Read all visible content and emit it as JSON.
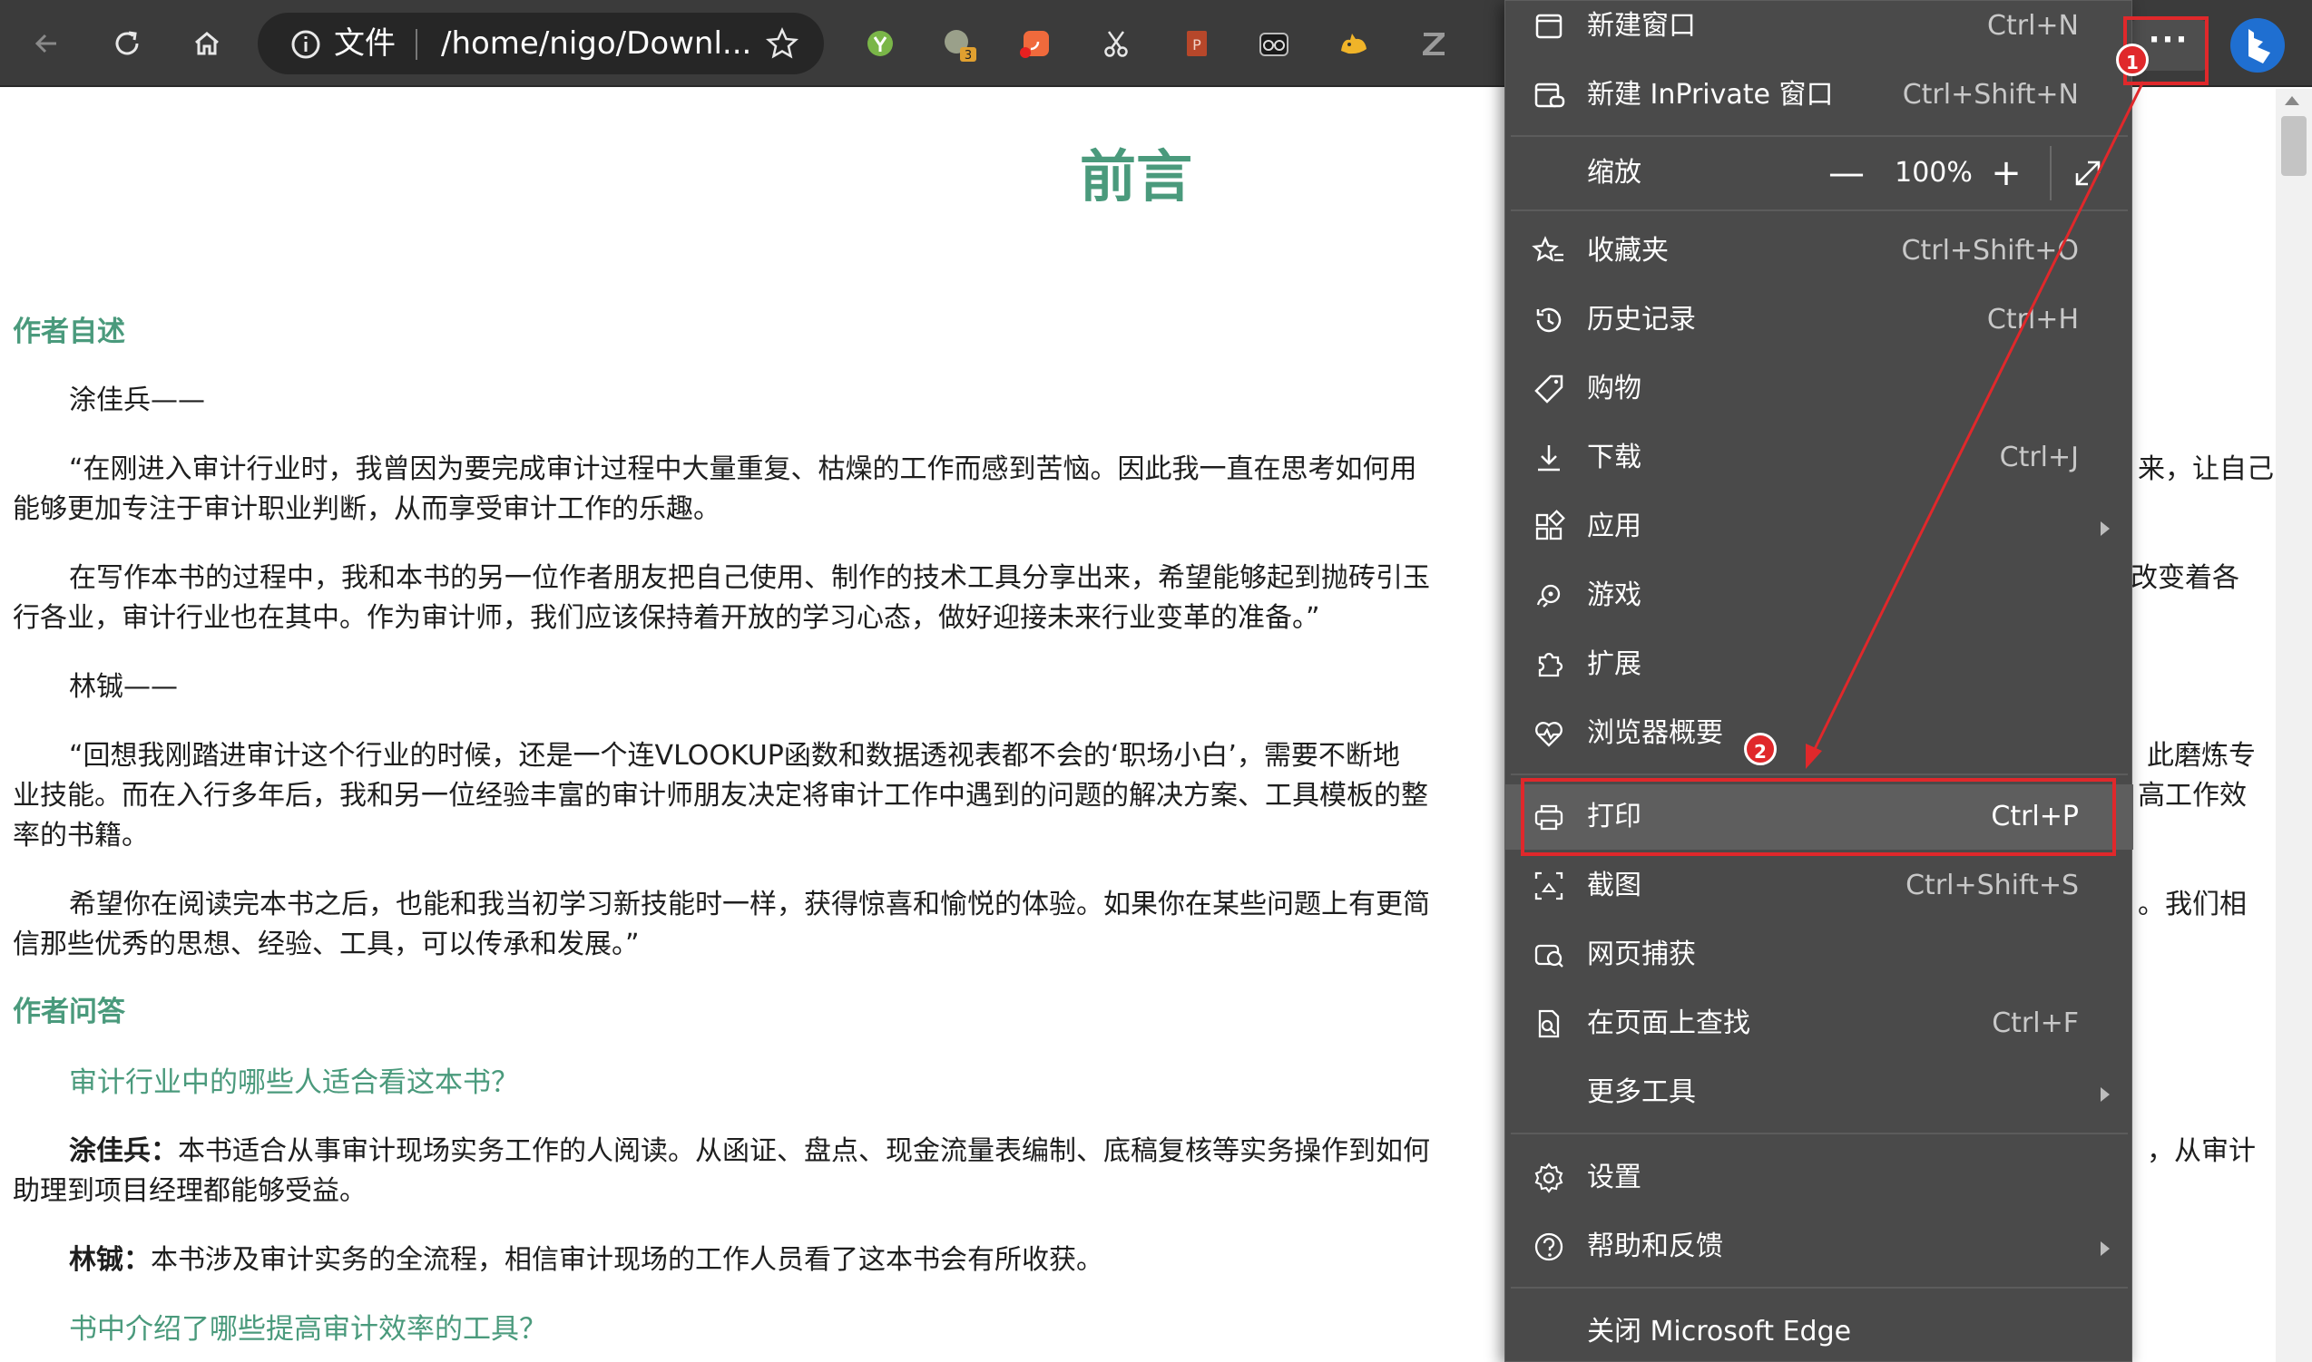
{
  "toolbar": {
    "address": {
      "file_label": "文件",
      "url": "/home/nigo/Downl..."
    },
    "extensions": [
      "yomi-extension-icon",
      "chat-extension-icon",
      "rss-extension-icon",
      "scissors-extension-icon",
      "powerpoint-extension-icon",
      "owl-extension-icon",
      "cat-extension-icon",
      "zotero-extension-icon"
    ],
    "ext_badge": "3",
    "more_label": "···"
  },
  "page": {
    "title": "前言",
    "section1_heading": "作者自述",
    "author1_line": "涂佳兵——",
    "para1_line1": "“在刚进入审计行业时，我曾因为要完成审计过程中大量重复、枯燥的工作而感到苦恼。因此我一直在思考如何用",
    "para1_line1_right": "来，让自己",
    "para1_line2": "能够更加专注于审计职业判断，从而享受审计工作的乐趣。",
    "para2_line1": "在写作本书的过程中，我和本书的另一位作者朋友把自己使用、制作的技术工具分享出来，希望能够起到抛砖引玉",
    "para2_line1_right": "改变着各",
    "para2_line2": "行各业，审计行业也在其中。作为审计师，我们应该保持着开放的学习心态，做好迎接未来行业变革的准备。”",
    "author2_line": "林铖——",
    "para3_line1": "“回想我刚踏进审计这个行业的时候，还是一个连VLOOKUP函数和数据透视表都不会的‘职场小白’，需要不断地",
    "para3_line1_right": "此磨炼专",
    "para3_line2": "业技能。而在入行多年后，我和另一位经验丰富的审计师朋友决定将审计工作中遇到的问题的解决方案、工具模板的整",
    "para3_line2_right": "高工作效",
    "para3_line3": "率的书籍。",
    "para4_line1": "希望你在阅读完本书之后，也能和我当初学习新技能时一样，获得惊喜和愉悦的体验。如果你在某些问题上有更简",
    "para4_line1_right": "。我们相",
    "para4_line2": "信那些优秀的思想、经验、工具，可以传承和发展。”",
    "section2_heading": "作者问答",
    "q1": "审计行业中的哪些人适合看这本书？",
    "a1_name": "涂佳兵：",
    "a1_line1": "本书适合从事审计现场实务工作的人阅读。从函证、盘点、现金流量表编制、底稿复核等实务操作到如何",
    "a1_line1_right": "，从审计",
    "a1_line2": "助理到项目经理都能够受益。",
    "a2_name": "林铖：",
    "a2_text": "本书涉及审计实务的全流程，相信审计现场的工作人员看了这本书会有所收获。",
    "q2": "书中介绍了哪些提高审计效率的工具？"
  },
  "menu": {
    "new_window": {
      "label": "新建窗口",
      "shortcut": "Ctrl+N"
    },
    "new_private": {
      "label": "新建 InPrivate 窗口",
      "shortcut": "Ctrl+Shift+N"
    },
    "zoom": {
      "label": "缩放",
      "minus": "—",
      "value": "100%",
      "plus": "+"
    },
    "favorites": {
      "label": "收藏夹",
      "shortcut": "Ctrl+Shift+O"
    },
    "history": {
      "label": "历史记录",
      "shortcut": "Ctrl+H"
    },
    "shopping": {
      "label": "购物"
    },
    "downloads": {
      "label": "下载",
      "shortcut": "Ctrl+J"
    },
    "apps": {
      "label": "应用"
    },
    "games": {
      "label": "游戏"
    },
    "extensions": {
      "label": "扩展"
    },
    "essentials": {
      "label": "浏览器概要"
    },
    "print": {
      "label": "打印",
      "shortcut": "Ctrl+P"
    },
    "screenshot": {
      "label": "截图",
      "shortcut": "Ctrl+Shift+S"
    },
    "web_capture": {
      "label": "网页捕获"
    },
    "find": {
      "label": "在页面上查找",
      "shortcut": "Ctrl+F"
    },
    "more_tools": {
      "label": "更多工具"
    },
    "settings": {
      "label": "设置"
    },
    "help": {
      "label": "帮助和反馈"
    },
    "close_edge": {
      "label": "关闭 Microsoft Edge"
    }
  },
  "annotations": {
    "badge1": "1",
    "badge2": "2",
    "color": "#e0282b"
  },
  "colors": {
    "toolbar_bg": "#3b3b3b",
    "menu_bg": "#4a4a4a",
    "heading_green": "#4a9a7c"
  }
}
